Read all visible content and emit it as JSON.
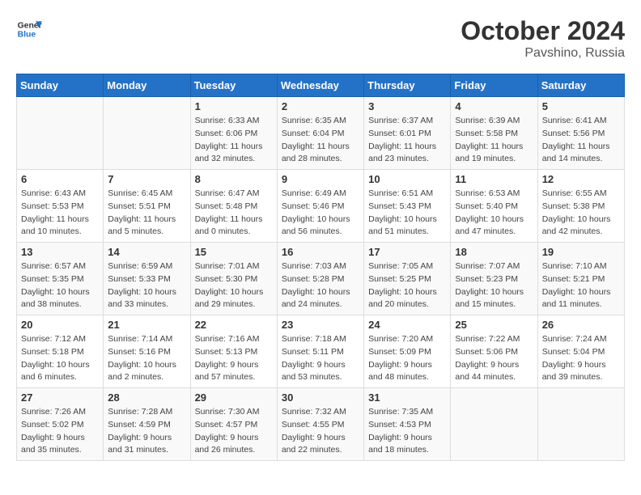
{
  "logo": {
    "line1": "General",
    "line2": "Blue"
  },
  "title": "October 2024",
  "location": "Pavshino, Russia",
  "days_header": [
    "Sunday",
    "Monday",
    "Tuesday",
    "Wednesday",
    "Thursday",
    "Friday",
    "Saturday"
  ],
  "weeks": [
    [
      {
        "day": "",
        "info": ""
      },
      {
        "day": "",
        "info": ""
      },
      {
        "day": "1",
        "info": "Sunrise: 6:33 AM\nSunset: 6:06 PM\nDaylight: 11 hours and 32 minutes."
      },
      {
        "day": "2",
        "info": "Sunrise: 6:35 AM\nSunset: 6:04 PM\nDaylight: 11 hours and 28 minutes."
      },
      {
        "day": "3",
        "info": "Sunrise: 6:37 AM\nSunset: 6:01 PM\nDaylight: 11 hours and 23 minutes."
      },
      {
        "day": "4",
        "info": "Sunrise: 6:39 AM\nSunset: 5:58 PM\nDaylight: 11 hours and 19 minutes."
      },
      {
        "day": "5",
        "info": "Sunrise: 6:41 AM\nSunset: 5:56 PM\nDaylight: 11 hours and 14 minutes."
      }
    ],
    [
      {
        "day": "6",
        "info": "Sunrise: 6:43 AM\nSunset: 5:53 PM\nDaylight: 11 hours and 10 minutes."
      },
      {
        "day": "7",
        "info": "Sunrise: 6:45 AM\nSunset: 5:51 PM\nDaylight: 11 hours and 5 minutes."
      },
      {
        "day": "8",
        "info": "Sunrise: 6:47 AM\nSunset: 5:48 PM\nDaylight: 11 hours and 0 minutes."
      },
      {
        "day": "9",
        "info": "Sunrise: 6:49 AM\nSunset: 5:46 PM\nDaylight: 10 hours and 56 minutes."
      },
      {
        "day": "10",
        "info": "Sunrise: 6:51 AM\nSunset: 5:43 PM\nDaylight: 10 hours and 51 minutes."
      },
      {
        "day": "11",
        "info": "Sunrise: 6:53 AM\nSunset: 5:40 PM\nDaylight: 10 hours and 47 minutes."
      },
      {
        "day": "12",
        "info": "Sunrise: 6:55 AM\nSunset: 5:38 PM\nDaylight: 10 hours and 42 minutes."
      }
    ],
    [
      {
        "day": "13",
        "info": "Sunrise: 6:57 AM\nSunset: 5:35 PM\nDaylight: 10 hours and 38 minutes."
      },
      {
        "day": "14",
        "info": "Sunrise: 6:59 AM\nSunset: 5:33 PM\nDaylight: 10 hours and 33 minutes."
      },
      {
        "day": "15",
        "info": "Sunrise: 7:01 AM\nSunset: 5:30 PM\nDaylight: 10 hours and 29 minutes."
      },
      {
        "day": "16",
        "info": "Sunrise: 7:03 AM\nSunset: 5:28 PM\nDaylight: 10 hours and 24 minutes."
      },
      {
        "day": "17",
        "info": "Sunrise: 7:05 AM\nSunset: 5:25 PM\nDaylight: 10 hours and 20 minutes."
      },
      {
        "day": "18",
        "info": "Sunrise: 7:07 AM\nSunset: 5:23 PM\nDaylight: 10 hours and 15 minutes."
      },
      {
        "day": "19",
        "info": "Sunrise: 7:10 AM\nSunset: 5:21 PM\nDaylight: 10 hours and 11 minutes."
      }
    ],
    [
      {
        "day": "20",
        "info": "Sunrise: 7:12 AM\nSunset: 5:18 PM\nDaylight: 10 hours and 6 minutes."
      },
      {
        "day": "21",
        "info": "Sunrise: 7:14 AM\nSunset: 5:16 PM\nDaylight: 10 hours and 2 minutes."
      },
      {
        "day": "22",
        "info": "Sunrise: 7:16 AM\nSunset: 5:13 PM\nDaylight: 9 hours and 57 minutes."
      },
      {
        "day": "23",
        "info": "Sunrise: 7:18 AM\nSunset: 5:11 PM\nDaylight: 9 hours and 53 minutes."
      },
      {
        "day": "24",
        "info": "Sunrise: 7:20 AM\nSunset: 5:09 PM\nDaylight: 9 hours and 48 minutes."
      },
      {
        "day": "25",
        "info": "Sunrise: 7:22 AM\nSunset: 5:06 PM\nDaylight: 9 hours and 44 minutes."
      },
      {
        "day": "26",
        "info": "Sunrise: 7:24 AM\nSunset: 5:04 PM\nDaylight: 9 hours and 39 minutes."
      }
    ],
    [
      {
        "day": "27",
        "info": "Sunrise: 7:26 AM\nSunset: 5:02 PM\nDaylight: 9 hours and 35 minutes."
      },
      {
        "day": "28",
        "info": "Sunrise: 7:28 AM\nSunset: 4:59 PM\nDaylight: 9 hours and 31 minutes."
      },
      {
        "day": "29",
        "info": "Sunrise: 7:30 AM\nSunset: 4:57 PM\nDaylight: 9 hours and 26 minutes."
      },
      {
        "day": "30",
        "info": "Sunrise: 7:32 AM\nSunset: 4:55 PM\nDaylight: 9 hours and 22 minutes."
      },
      {
        "day": "31",
        "info": "Sunrise: 7:35 AM\nSunset: 4:53 PM\nDaylight: 9 hours and 18 minutes."
      },
      {
        "day": "",
        "info": ""
      },
      {
        "day": "",
        "info": ""
      }
    ]
  ]
}
